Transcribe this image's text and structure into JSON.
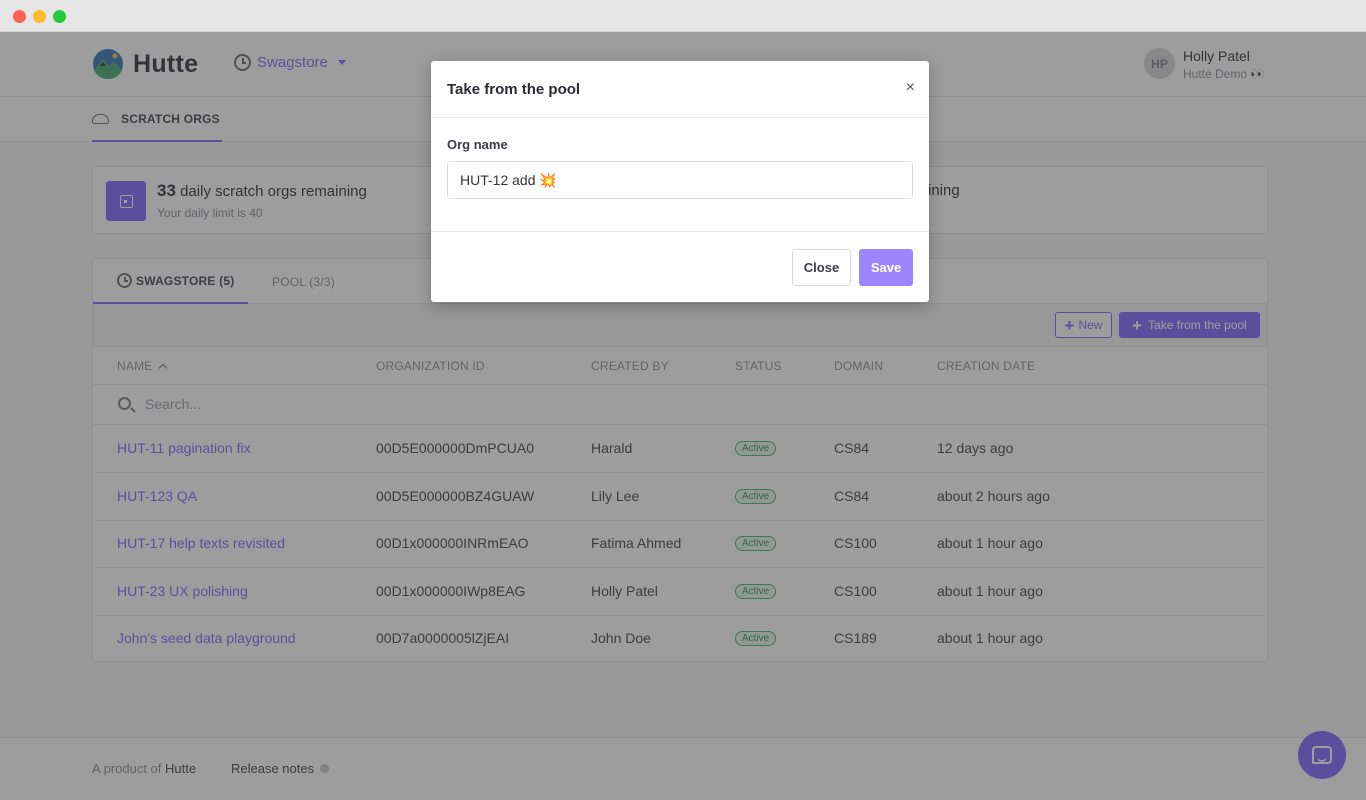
{
  "window": {
    "traffic_lights": [
      "close",
      "minimize",
      "zoom"
    ]
  },
  "header": {
    "brand": "Hutte",
    "project": "Swagstore",
    "user": {
      "initials": "HP",
      "name": "Holly Patel",
      "org": "Hutte Demo 👀"
    }
  },
  "subnav": {
    "tab_label": "SCRATCH ORGS"
  },
  "stats": {
    "count": "33",
    "title_rest": " daily scratch orgs remaining",
    "subtitle": "Your daily limit is 40",
    "right_text_fragment": "ining"
  },
  "tabs": {
    "active": "SWAGSTORE (5)",
    "inactive": "POOL (3/3)"
  },
  "toolbar": {
    "new_label": "New",
    "take_label": "Take from the pool"
  },
  "table": {
    "columns": [
      "NAME",
      "ORGANIZATION ID",
      "CREATED BY",
      "STATUS",
      "DOMAIN",
      "CREATION DATE"
    ],
    "search_placeholder": "Search...",
    "rows": [
      {
        "name": "HUT-11 pagination fix",
        "org_id": "00D5E000000DmPCUA0",
        "created_by": "Harald",
        "status": "Active",
        "domain": "CS84",
        "date": "12 days ago"
      },
      {
        "name": "HUT-123 QA",
        "org_id": "00D5E000000BZ4GUAW",
        "created_by": "Lily Lee",
        "status": "Active",
        "domain": "CS84",
        "date": "about 2 hours ago"
      },
      {
        "name": "HUT-17 help texts revisited",
        "org_id": "00D1x000000INRmEAO",
        "created_by": "Fatima Ahmed",
        "status": "Active",
        "domain": "CS100",
        "date": "about 1 hour ago"
      },
      {
        "name": "HUT-23 UX polishing",
        "org_id": "00D1x000000IWp8EAG",
        "created_by": "Holly Patel",
        "status": "Active",
        "domain": "CS100",
        "date": "about 1 hour ago"
      },
      {
        "name": "John's seed data playground",
        "org_id": "00D7a0000005lZjEAI",
        "created_by": "John Doe",
        "status": "Active",
        "domain": "CS189",
        "date": "about 1 hour ago"
      }
    ]
  },
  "footer": {
    "product_prefix": "A product of ",
    "product_name": "Hutte",
    "release_notes": "Release notes"
  },
  "modal": {
    "title": "Take from the pool",
    "close_glyph": "×",
    "field_label": "Org name",
    "field_value": "HUT-12 add 💥",
    "close_label": "Close",
    "save_label": "Save"
  },
  "colors": {
    "accent": "#7b61ff",
    "active_badge": "#38b26a"
  }
}
